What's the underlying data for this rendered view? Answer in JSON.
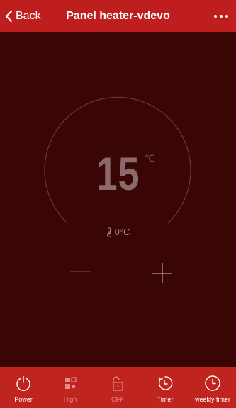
{
  "header": {
    "back_label": "Back",
    "title": "Panel heater-vdevo",
    "more_label": "•••"
  },
  "thermostat": {
    "set_temp": "15",
    "set_unit": "℃",
    "current_temp": "0°C",
    "minus_icon": "minus-icon",
    "plus_icon": "plus-icon"
  },
  "bottom_bar": {
    "items": [
      {
        "label": "Power",
        "icon": "power-icon",
        "enabled": true
      },
      {
        "label": "High",
        "icon": "mode-icon",
        "enabled": false
      },
      {
        "label": "OFF",
        "icon": "lock-icon",
        "enabled": false
      },
      {
        "label": "Timer",
        "icon": "timer-icon",
        "enabled": true
      },
      {
        "label": "weekly timer",
        "icon": "clock-icon",
        "enabled": true
      }
    ]
  },
  "colors": {
    "header_bg": "#bf1e1e",
    "main_bg": "#3a0505",
    "bottom_bar_bg": "#c0241f",
    "active_text": "#ffffff",
    "dim_text": "#e58a86"
  }
}
